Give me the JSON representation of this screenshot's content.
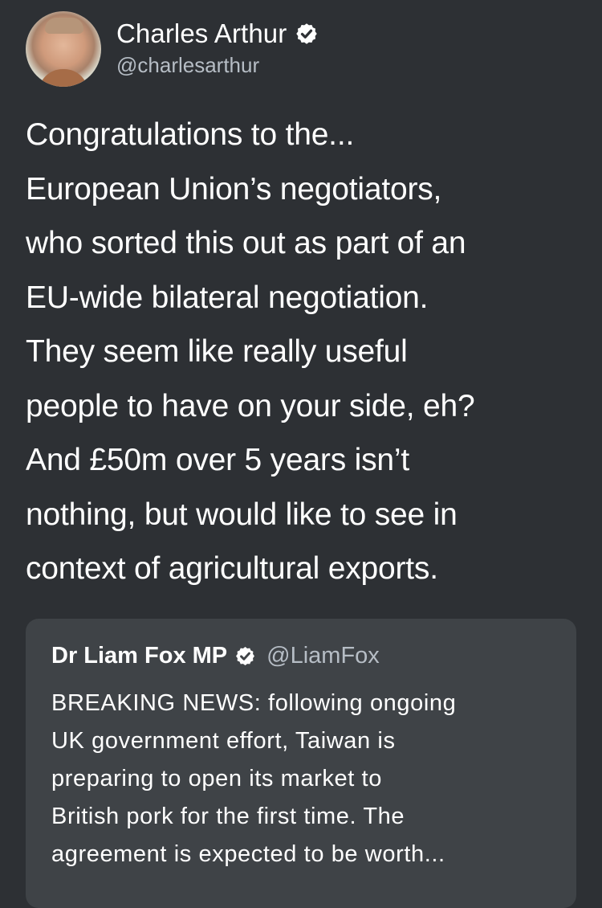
{
  "tweet": {
    "author_name": "Charles Arthur",
    "author_handle": "@charlesarthur",
    "verified_icon": "verified-badge-icon",
    "text": "Congratulations to the...\nEuropean Union’s negotiators,\nwho sorted this out as part of an\nEU-wide bilateral negotiation.\nThey seem like really useful\npeople to have on your side, eh?\nAnd £50m over 5 years isn’t\nnothing, but would like to see in\ncontext of agricultural exports."
  },
  "quoted_tweet": {
    "author_name": "Dr Liam Fox MP",
    "author_handle": "@LiamFox",
    "verified_icon": "verified-badge-icon",
    "text": "BREAKING NEWS: following ongoing\nUK government effort, Taiwan is\npreparing to open its market to\nBritish pork for the first time. The\nagreement is expected to be worth..."
  },
  "colors": {
    "background": "#2d3034",
    "quote_card": "#3f4347",
    "secondary_text": "#b6bdc5",
    "primary_text": "#ffffff"
  }
}
